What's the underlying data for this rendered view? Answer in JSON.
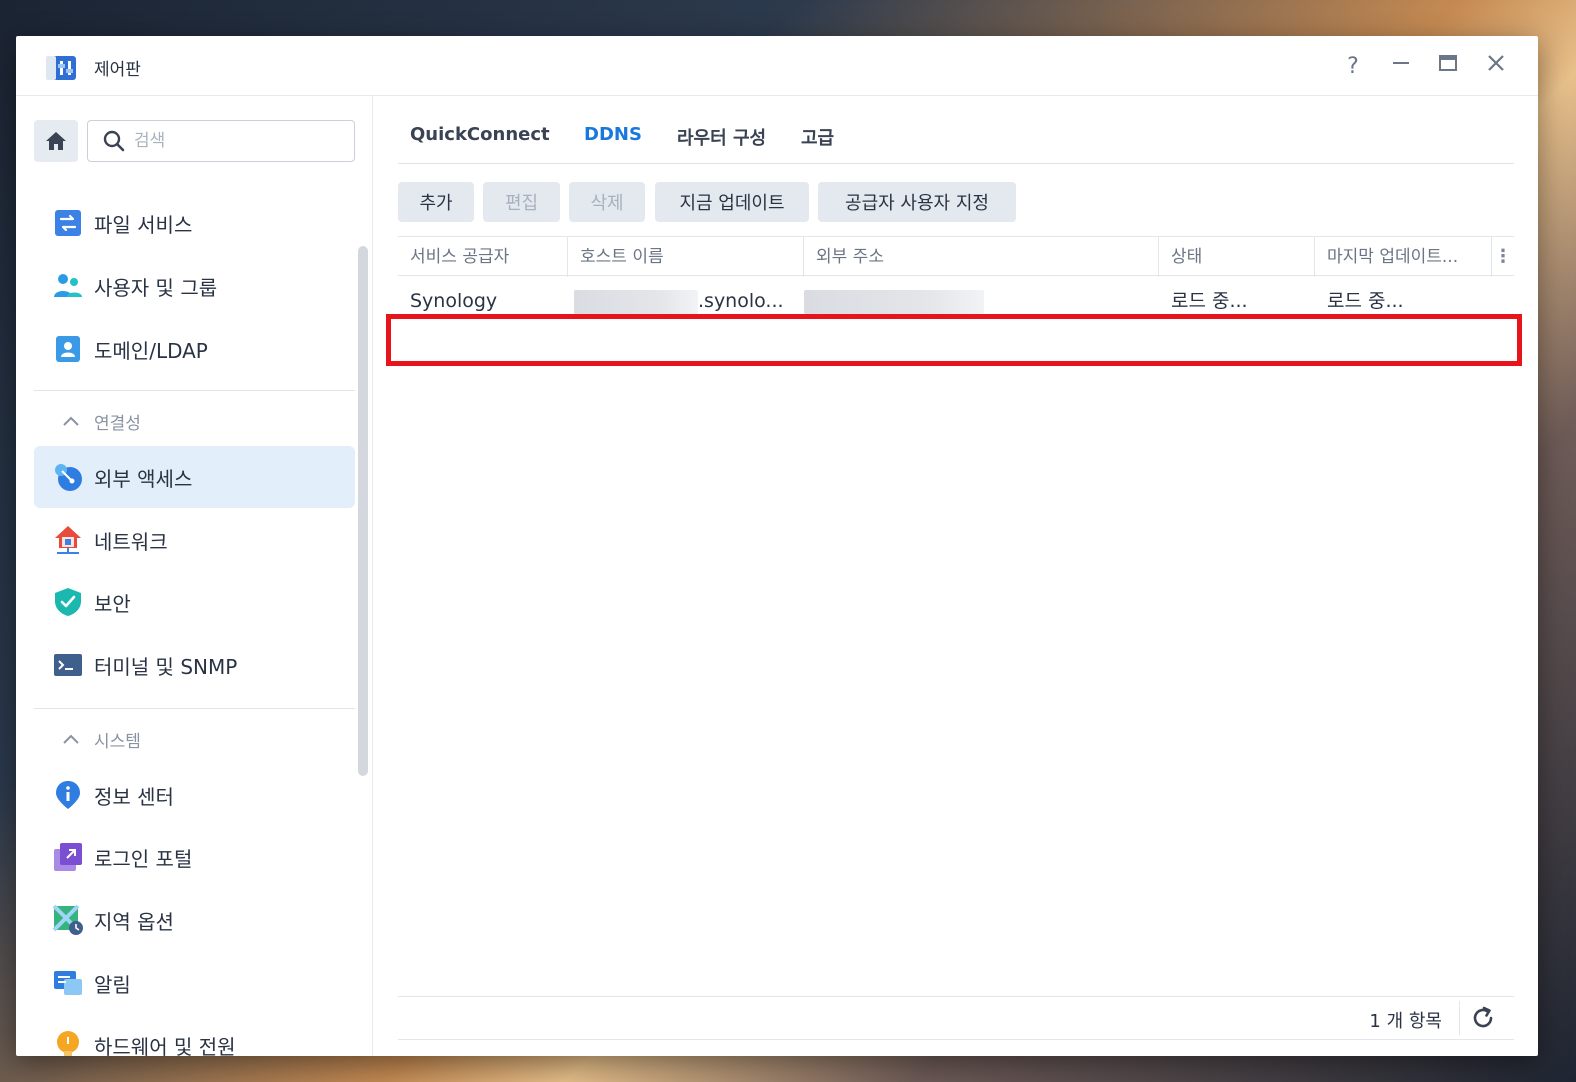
{
  "window": {
    "title": "제어판",
    "controls": [
      "?",
      "—",
      "□",
      "✕"
    ]
  },
  "sidebar": {
    "search_placeholder": "검색",
    "items_top": [
      {
        "label": "파일 서비스",
        "icon": "file-services-icon"
      },
      {
        "label": "사용자 및 그룹",
        "icon": "users-group-icon"
      },
      {
        "label": "도메인/LDAP",
        "icon": "domain-ldap-icon"
      }
    ],
    "section_connectivity": "연결성",
    "items_connectivity": [
      {
        "label": "외부 액세스",
        "icon": "external-access-icon",
        "active": true
      },
      {
        "label": "네트워크",
        "icon": "network-icon"
      },
      {
        "label": "보안",
        "icon": "security-shield-icon"
      },
      {
        "label": "터미널 및 SNMP",
        "icon": "terminal-icon"
      }
    ],
    "section_system": "시스템",
    "items_system": [
      {
        "label": "정보 센터",
        "icon": "info-center-icon"
      },
      {
        "label": "로그인 포털",
        "icon": "login-portal-icon"
      },
      {
        "label": "지역 옵션",
        "icon": "regional-options-icon"
      },
      {
        "label": "알림",
        "icon": "notification-icon"
      },
      {
        "label": "하드웨어 및 전원",
        "icon": "hardware-power-icon"
      }
    ]
  },
  "main": {
    "tabs": [
      "QuickConnect",
      "DDNS",
      "라우터 구성",
      "고급"
    ],
    "active_tab": "DDNS",
    "toolbar": {
      "add": "추가",
      "edit": "편집",
      "delete": "삭제",
      "update_now": "지금 업데이트",
      "customize_provider": "공급자 사용자 지정"
    },
    "table": {
      "columns": [
        "서비스 공급자",
        "호스트 이름",
        "외부 주소",
        "상태",
        "마지막 업데이트..."
      ],
      "rows": [
        {
          "provider": "Synology",
          "hostname_suffix": ".synolo...",
          "status": "로드 중...",
          "last_update": "로드 중..."
        }
      ]
    },
    "footer": {
      "count": "1 개 항목"
    }
  },
  "colors": {
    "accent": "#1a78dc",
    "highlight": "#e8141c",
    "active_bg": "#e3eefb"
  }
}
